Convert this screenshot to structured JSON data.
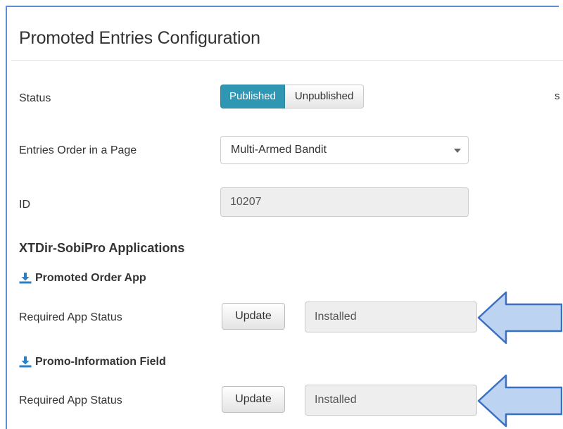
{
  "panel": {
    "title": "Promoted Entries Configuration"
  },
  "status": {
    "label": "Status",
    "options": [
      "Published",
      "Unpublished"
    ],
    "selected": "Published"
  },
  "entries_order": {
    "label": "Entries Order in a Page",
    "value": "Multi-Armed Bandit"
  },
  "id_field": {
    "label": "ID",
    "value": "10207"
  },
  "applications": {
    "title": "XTDir-SobiPro Applications",
    "apps": [
      {
        "name": "Promoted Order App",
        "status_label": "Required App Status",
        "button_label": "Update",
        "status_value": "Installed"
      },
      {
        "name": "Promo-Information Field",
        "status_label": "Required App Status",
        "button_label": "Update",
        "status_value": "Installed"
      }
    ]
  },
  "right_fragment": "s",
  "colors": {
    "accent": "#2f96b4",
    "arrow_fill": "#bcd4f2",
    "arrow_stroke": "#3a6fc1",
    "frame": "#5b8fd0"
  },
  "icons": [
    "download-icon",
    "chevron-down-icon",
    "callout-arrow"
  ]
}
